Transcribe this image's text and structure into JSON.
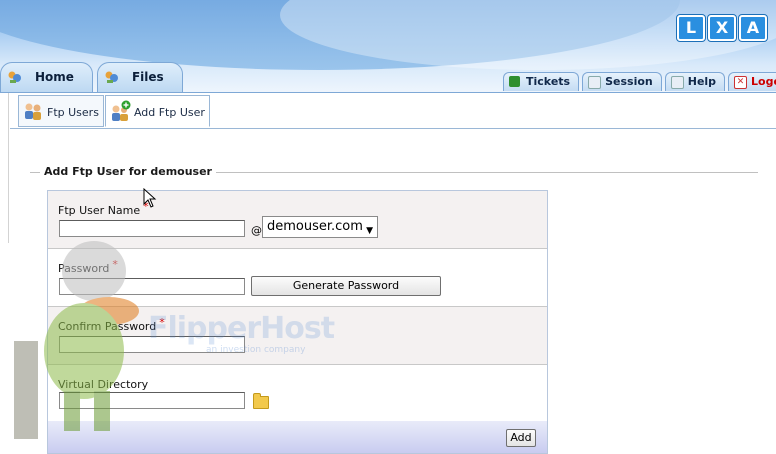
{
  "header": {
    "logo_letters": [
      "L",
      "X",
      "A"
    ],
    "main_tabs": [
      {
        "label": "Home"
      },
      {
        "label": "Files"
      }
    ],
    "right_tabs": [
      {
        "label": "Tickets",
        "icon": "tickets-icon"
      },
      {
        "label": "Session",
        "icon": "session-icon"
      },
      {
        "label": "Help",
        "icon": "help-icon"
      },
      {
        "label": "Logout",
        "icon": "close-icon"
      }
    ]
  },
  "subtabs": [
    {
      "label": "Ftp Users",
      "icon": "users-icon"
    },
    {
      "label": "Add Ftp User",
      "icon": "add-user-icon"
    }
  ],
  "form": {
    "legend": "Add Ftp User for demouser",
    "username_label": "Ftp User Name",
    "required_mark": "*",
    "at_sign": "@",
    "domain_value": "demouser.com",
    "password_label": "Password",
    "generate_password_label": "Generate Password",
    "confirm_password_label": "Confirm Password",
    "directory_label": "Virtual Directory",
    "add_label": "Add"
  },
  "watermark": {
    "brand": "FlipperHost",
    "tagline": "an investion company"
  },
  "colors": {
    "header_blue": "#7fb0e6",
    "required_red": "#d40000",
    "logout_red": "#cc0000",
    "footer_bar": "#c9ccf0"
  }
}
